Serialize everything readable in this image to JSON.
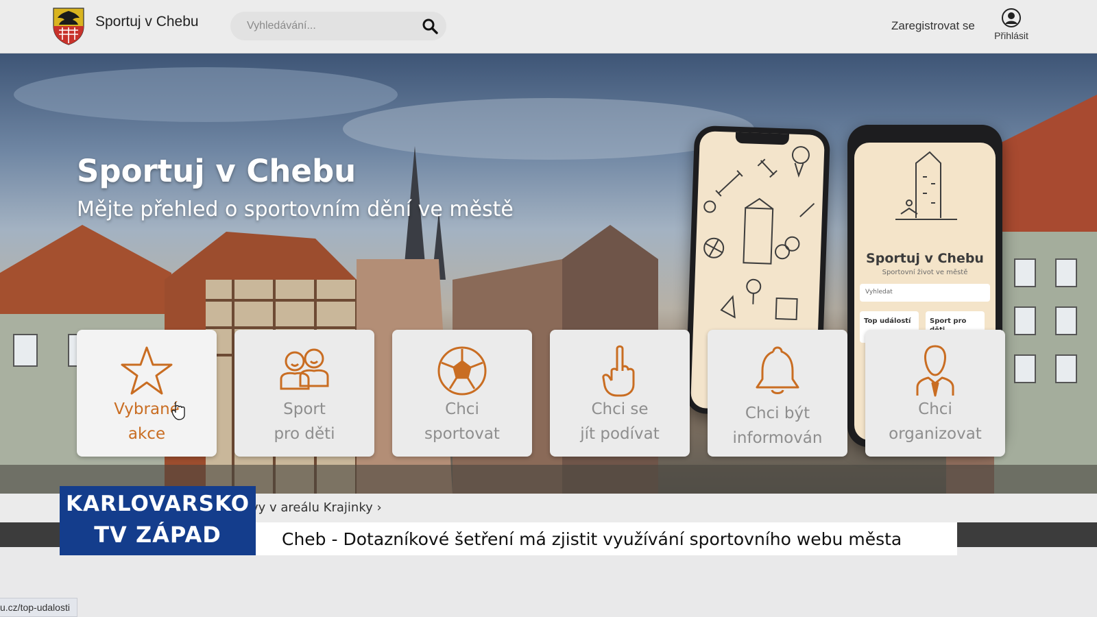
{
  "header": {
    "site_title": "Sportuj v Chebu",
    "search_placeholder": "Vyhledávání...",
    "register_label": "Zaregistrovat se",
    "login_label": "Přihlásit"
  },
  "hero": {
    "title": "Sportuj v Chebu",
    "subtitle": "Mějte přehled o sportovním dění ve městě"
  },
  "phone_mockup": {
    "title": "Sportuj v Chebu",
    "subtitle": "Sportovní život ve městě",
    "search_placeholder": "Vyhledat",
    "card_top": "Top událostí",
    "card_kids": "Sport pro děti"
  },
  "tiles": [
    {
      "label": "Vybrané akce",
      "icon": "star-icon"
    },
    {
      "label": "Sport pro děti",
      "icon": "kids-icon"
    },
    {
      "label": "Chci sportovat",
      "icon": "soccer-ball-icon"
    },
    {
      "label": "Chci se jít podívat",
      "icon": "pointing-hand-icon"
    },
    {
      "label": "Chci být informován",
      "icon": "bell-icon"
    },
    {
      "label": "Chci organizovat",
      "icon": "person-tie-icon"
    }
  ],
  "tile_lines": {
    "t0": [
      "Vybrané",
      "akce"
    ],
    "t1": [
      "Sport",
      "pro děti"
    ],
    "t2": [
      "Chci",
      "sportovat"
    ],
    "t3": [
      "Chci se",
      "jít podívat"
    ],
    "t4": [
      "Chci být",
      "informován"
    ],
    "t5": [
      "Chci",
      "organizovat"
    ]
  },
  "strip": {
    "link_text": "vy v areálu Krajinky"
  },
  "tv_overlay": {
    "logo_line1": "KARLOVARSKO",
    "logo_line2": "TV ZÁPAD",
    "ticker": "Cheb - Dotazníkové šetření má zjistit využívání sportovního webu města"
  },
  "status_bar": {
    "url": "u.cz/top-udalosti"
  },
  "colors": {
    "accent": "#c96d22",
    "tile_bg": "#ebebeb",
    "tv_blue": "#143d8c"
  }
}
